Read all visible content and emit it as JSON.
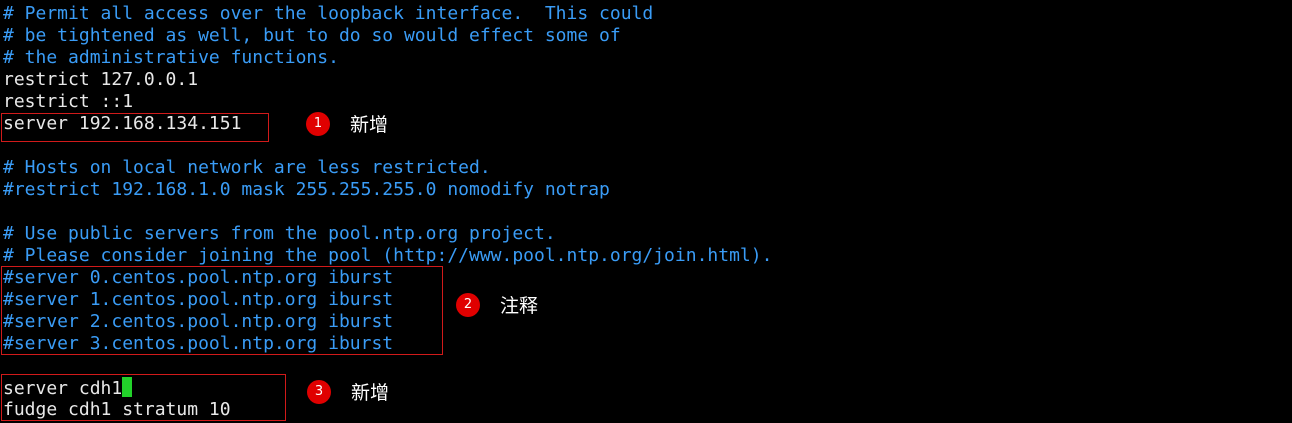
{
  "terminal": {
    "lines": [
      {
        "text": "# Permit all access over the loopback interface.  This could",
        "kind": "comment"
      },
      {
        "text": "# be tightened as well, but to do so would effect some of",
        "kind": "comment"
      },
      {
        "text": "# the administrative functions.",
        "kind": "comment"
      },
      {
        "text": "restrict 127.0.0.1",
        "kind": "plain"
      },
      {
        "text": "restrict ::1",
        "kind": "plain"
      },
      {
        "text": "server 192.168.134.151",
        "kind": "plain"
      },
      {
        "text": "",
        "kind": "plain"
      },
      {
        "text": "# Hosts on local network are less restricted.",
        "kind": "comment"
      },
      {
        "text": "#restrict 192.168.1.0 mask 255.255.255.0 nomodify notrap",
        "kind": "comment"
      },
      {
        "text": "",
        "kind": "plain"
      },
      {
        "text": "# Use public servers from the pool.ntp.org project.",
        "kind": "comment"
      },
      {
        "text": "# Please consider joining the pool (http://www.pool.ntp.org/join.html).",
        "kind": "comment"
      },
      {
        "text": "#server 0.centos.pool.ntp.org iburst",
        "kind": "comment"
      },
      {
        "text": "#server 1.centos.pool.ntp.org iburst",
        "kind": "comment"
      },
      {
        "text": "#server 2.centos.pool.ntp.org iburst",
        "kind": "comment"
      },
      {
        "text": "#server 3.centos.pool.ntp.org iburst",
        "kind": "comment"
      },
      {
        "text": "",
        "kind": "plain"
      },
      {
        "text": "server cdh1",
        "kind": "plain"
      },
      {
        "text": "fudge cdh1 stratum 10",
        "kind": "plain"
      }
    ]
  },
  "annotations": [
    {
      "number": "1",
      "label": "新增"
    },
    {
      "number": "2",
      "label": "注释"
    },
    {
      "number": "3",
      "label": "新增"
    }
  ],
  "colors": {
    "background": "#000000",
    "comment": "#3a9cf6",
    "plain": "#e8e8e8",
    "cursor": "#22d22a",
    "highlight": "#d11a1a",
    "badge": "#e00000"
  }
}
